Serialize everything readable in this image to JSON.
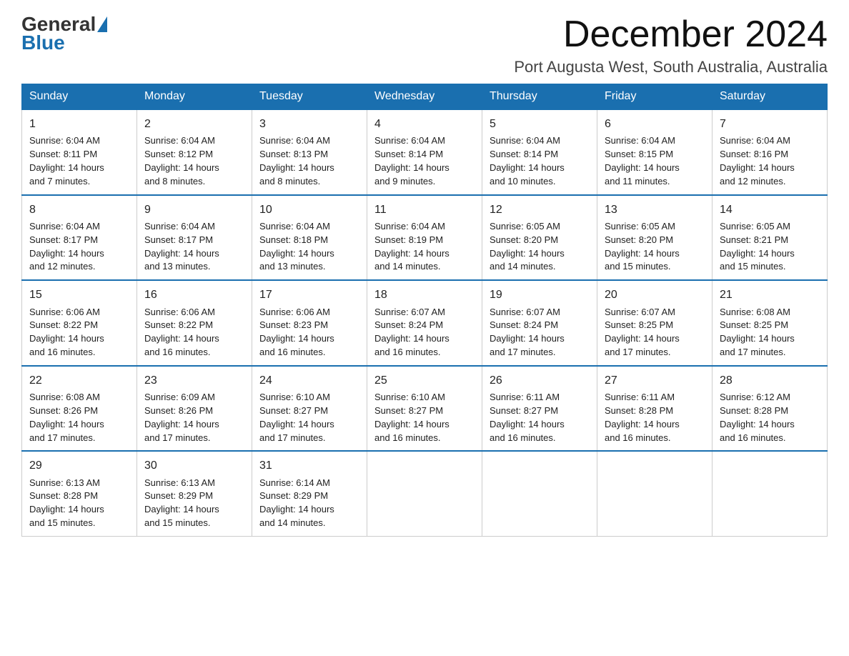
{
  "logo": {
    "general": "General",
    "blue": "Blue"
  },
  "header": {
    "month_year": "December 2024",
    "location": "Port Augusta West, South Australia, Australia"
  },
  "days_of_week": [
    "Sunday",
    "Monday",
    "Tuesday",
    "Wednesday",
    "Thursday",
    "Friday",
    "Saturday"
  ],
  "weeks": [
    [
      {
        "day": "1",
        "sunrise": "6:04 AM",
        "sunset": "8:11 PM",
        "daylight": "14 hours and 7 minutes."
      },
      {
        "day": "2",
        "sunrise": "6:04 AM",
        "sunset": "8:12 PM",
        "daylight": "14 hours and 8 minutes."
      },
      {
        "day": "3",
        "sunrise": "6:04 AM",
        "sunset": "8:13 PM",
        "daylight": "14 hours and 8 minutes."
      },
      {
        "day": "4",
        "sunrise": "6:04 AM",
        "sunset": "8:14 PM",
        "daylight": "14 hours and 9 minutes."
      },
      {
        "day": "5",
        "sunrise": "6:04 AM",
        "sunset": "8:14 PM",
        "daylight": "14 hours and 10 minutes."
      },
      {
        "day": "6",
        "sunrise": "6:04 AM",
        "sunset": "8:15 PM",
        "daylight": "14 hours and 11 minutes."
      },
      {
        "day": "7",
        "sunrise": "6:04 AM",
        "sunset": "8:16 PM",
        "daylight": "14 hours and 12 minutes."
      }
    ],
    [
      {
        "day": "8",
        "sunrise": "6:04 AM",
        "sunset": "8:17 PM",
        "daylight": "14 hours and 12 minutes."
      },
      {
        "day": "9",
        "sunrise": "6:04 AM",
        "sunset": "8:17 PM",
        "daylight": "14 hours and 13 minutes."
      },
      {
        "day": "10",
        "sunrise": "6:04 AM",
        "sunset": "8:18 PM",
        "daylight": "14 hours and 13 minutes."
      },
      {
        "day": "11",
        "sunrise": "6:04 AM",
        "sunset": "8:19 PM",
        "daylight": "14 hours and 14 minutes."
      },
      {
        "day": "12",
        "sunrise": "6:05 AM",
        "sunset": "8:20 PM",
        "daylight": "14 hours and 14 minutes."
      },
      {
        "day": "13",
        "sunrise": "6:05 AM",
        "sunset": "8:20 PM",
        "daylight": "14 hours and 15 minutes."
      },
      {
        "day": "14",
        "sunrise": "6:05 AM",
        "sunset": "8:21 PM",
        "daylight": "14 hours and 15 minutes."
      }
    ],
    [
      {
        "day": "15",
        "sunrise": "6:06 AM",
        "sunset": "8:22 PM",
        "daylight": "14 hours and 16 minutes."
      },
      {
        "day": "16",
        "sunrise": "6:06 AM",
        "sunset": "8:22 PM",
        "daylight": "14 hours and 16 minutes."
      },
      {
        "day": "17",
        "sunrise": "6:06 AM",
        "sunset": "8:23 PM",
        "daylight": "14 hours and 16 minutes."
      },
      {
        "day": "18",
        "sunrise": "6:07 AM",
        "sunset": "8:24 PM",
        "daylight": "14 hours and 16 minutes."
      },
      {
        "day": "19",
        "sunrise": "6:07 AM",
        "sunset": "8:24 PM",
        "daylight": "14 hours and 17 minutes."
      },
      {
        "day": "20",
        "sunrise": "6:07 AM",
        "sunset": "8:25 PM",
        "daylight": "14 hours and 17 minutes."
      },
      {
        "day": "21",
        "sunrise": "6:08 AM",
        "sunset": "8:25 PM",
        "daylight": "14 hours and 17 minutes."
      }
    ],
    [
      {
        "day": "22",
        "sunrise": "6:08 AM",
        "sunset": "8:26 PM",
        "daylight": "14 hours and 17 minutes."
      },
      {
        "day": "23",
        "sunrise": "6:09 AM",
        "sunset": "8:26 PM",
        "daylight": "14 hours and 17 minutes."
      },
      {
        "day": "24",
        "sunrise": "6:10 AM",
        "sunset": "8:27 PM",
        "daylight": "14 hours and 17 minutes."
      },
      {
        "day": "25",
        "sunrise": "6:10 AM",
        "sunset": "8:27 PM",
        "daylight": "14 hours and 16 minutes."
      },
      {
        "day": "26",
        "sunrise": "6:11 AM",
        "sunset": "8:27 PM",
        "daylight": "14 hours and 16 minutes."
      },
      {
        "day": "27",
        "sunrise": "6:11 AM",
        "sunset": "8:28 PM",
        "daylight": "14 hours and 16 minutes."
      },
      {
        "day": "28",
        "sunrise": "6:12 AM",
        "sunset": "8:28 PM",
        "daylight": "14 hours and 16 minutes."
      }
    ],
    [
      {
        "day": "29",
        "sunrise": "6:13 AM",
        "sunset": "8:28 PM",
        "daylight": "14 hours and 15 minutes."
      },
      {
        "day": "30",
        "sunrise": "6:13 AM",
        "sunset": "8:29 PM",
        "daylight": "14 hours and 15 minutes."
      },
      {
        "day": "31",
        "sunrise": "6:14 AM",
        "sunset": "8:29 PM",
        "daylight": "14 hours and 14 minutes."
      },
      null,
      null,
      null,
      null
    ]
  ],
  "labels": {
    "sunrise": "Sunrise:",
    "sunset": "Sunset:",
    "daylight": "Daylight:"
  }
}
